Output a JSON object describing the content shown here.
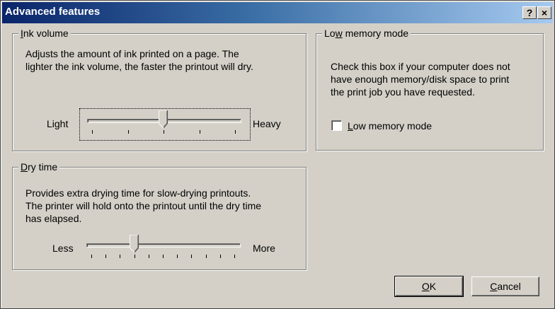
{
  "window": {
    "title": "Advanced features",
    "help_label": "?",
    "close_label": "×"
  },
  "ink_volume": {
    "legend_pre": "",
    "legend_accel": "I",
    "legend_post": "nk volume",
    "description_line1": "Adjusts the amount of ink printed on a page. The",
    "description_line2": "lighter the ink volume, the faster the printout will dry.",
    "min_label": "Light",
    "max_label": "Heavy",
    "value_fraction": 0.5
  },
  "low_memory": {
    "legend_pre": "Lo",
    "legend_accel": "w",
    "legend_post": " memory mode",
    "description_line1": "Check this box if your computer does not",
    "description_line2": "have enough memory/disk space to print",
    "description_line3": "the print job you have requested.",
    "checkbox_pre": "",
    "checkbox_accel": "L",
    "checkbox_post": "ow memory mode",
    "checked": false
  },
  "dry_time": {
    "legend_pre": "",
    "legend_accel": "D",
    "legend_post": "ry time",
    "description_line1": "Provides extra drying time for slow-drying printouts.",
    "description_line2": "The printer will hold onto the printout until the dry time",
    "description_line3": "has elapsed.",
    "min_label": "Less",
    "max_label": "More",
    "value_fraction": 0.3
  },
  "buttons": {
    "ok_accel": "O",
    "ok_post": "K",
    "cancel_accel": "C",
    "cancel_post": "ancel"
  }
}
